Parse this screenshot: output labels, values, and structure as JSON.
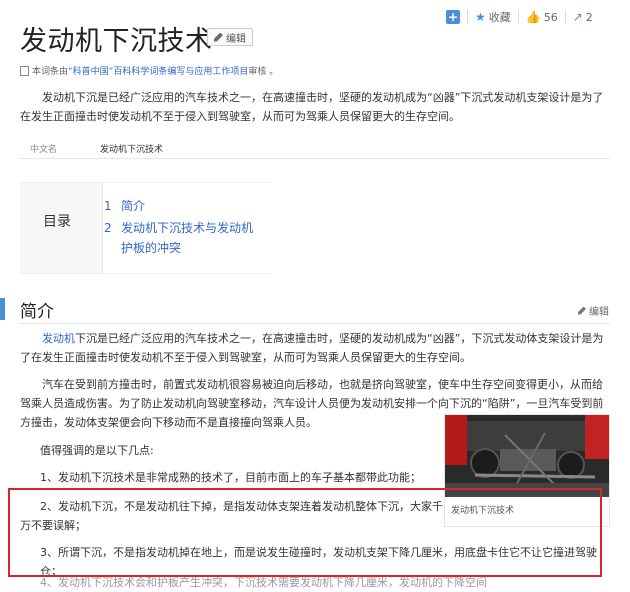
{
  "header": {
    "title": "发动机下沉技术",
    "edit_label": "编辑",
    "toolbar": {
      "add_icon": "plus",
      "favorite_label": "收藏",
      "like_count": "56",
      "share_count": "2"
    }
  },
  "source": {
    "prefix": "本词条由",
    "link": "“科普中国”百科科学词条编写与应用工作项目",
    "suffix": " 审核 。"
  },
  "intro": "发动机下沉是已经广泛应用的汽车技术之一，在高速撞击时，坚硬的发动机成为“凶器”下沉式发动机支架设计是为了在发生正面撞击时使发动机不至于侵入到驾驶室，从而可为驾乘人员保留更大的生存空间。",
  "basic_info": {
    "key": "中文名",
    "value": "发动机下沉技术"
  },
  "toc": {
    "title": "目录",
    "items": [
      {
        "num": "1",
        "label": "简介"
      },
      {
        "num": "2",
        "label": "发动机下沉技术与发动机"
      },
      {
        "num": "",
        "label": "护板的冲突"
      }
    ]
  },
  "section": {
    "title": "简介",
    "edit_label": "编辑",
    "p1_link": "发动机",
    "p1_rest": "下沉是已经广泛应用的汽车技术之一，在高速撞击时，坚硬的发动机成为“凶器”，下沉式发动体支架设计是为了在发生正面撞击时使发动机不至于侵入到驾驶室，从而可为驾乘人员保留更大的生存空间。",
    "p2": "汽车在受到前方撞击时，前置式发动机很容易被迫向后移动，也就是挤向驾驶室，使车中生存空间变得更小，从而给驾乘人员造成伤害。为了防止发动机向驾驶室移动，汽车设计人员便为发动机安排一个向下沉的“陷阱”，一旦汽车受到前方撞击，发动体支架便会向下移动而不是直接撞向驾乘人员。",
    "p3": "值得强调的是以下几点:",
    "p4": "1、发动机下沉技术是非常成熟的技术了，目前市面上的车子基本都带此功能；",
    "p5": "2、发动机下沉，不是发动机往下掉，是指发动体支架连着发动机整体下沉，大家千万不要误解；",
    "p6": "3、所谓下沉，不是指发动机掉在地上，而是说发生碰撞时，发动机支架下降几厘米，用底盘卡住它不让它撞进驾驶仓；",
    "p7": "4、发动机下沉技术会和护板产生冲突，下沉技术需要发动机下降几厘米，发动机的下降空间"
  },
  "figure": {
    "caption": "发动机下沉技术"
  },
  "colors": {
    "accent": "#4d8ed8",
    "link": "#3366cc",
    "highlight": "#d62828"
  }
}
